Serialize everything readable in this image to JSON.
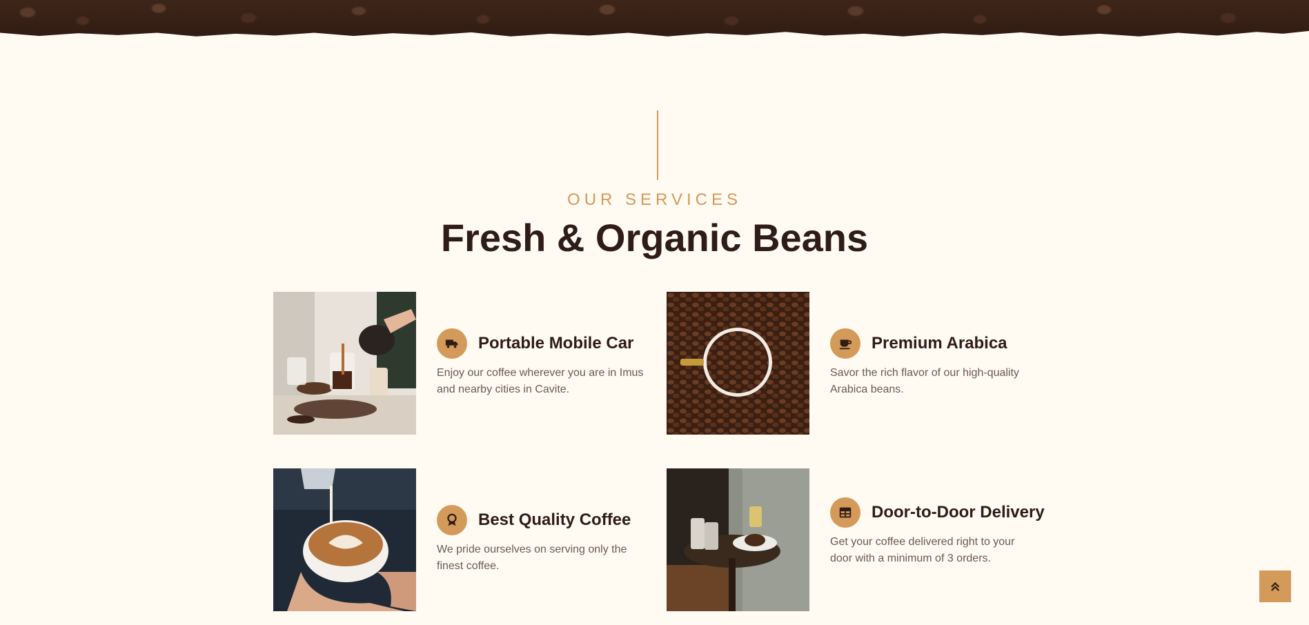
{
  "section": {
    "eyebrow": "OUR SERVICES",
    "headline": "Fresh & Organic Beans"
  },
  "services": [
    {
      "title": "Portable Mobile Car",
      "description": "Enjoy our coffee wherever you are in Imus and nearby cities in Cavite.",
      "icon": "truck-icon",
      "image": "pour-over-coffee-image"
    },
    {
      "title": "Premium Arabica",
      "description": "Savor the rich flavor of our high-quality Arabica beans.",
      "icon": "coffee-cup-icon",
      "image": "coffee-beans-cup-image"
    },
    {
      "title": "Best Quality Coffee",
      "description": "We pride ourselves on serving only the finest coffee.",
      "icon": "award-icon",
      "image": "latte-art-image"
    },
    {
      "title": "Door-to-Door Delivery",
      "description": "Get your coffee delivered right to your door with a minimum of 3 orders.",
      "icon": "table-icon",
      "image": "cafe-table-image"
    }
  ],
  "back_to_top": {
    "icon": "double-chevron-up-icon"
  },
  "colors": {
    "background": "#fffaf2",
    "accent": "#d49a5a",
    "heading": "#2e1c16",
    "body_text": "#6a5a52"
  }
}
